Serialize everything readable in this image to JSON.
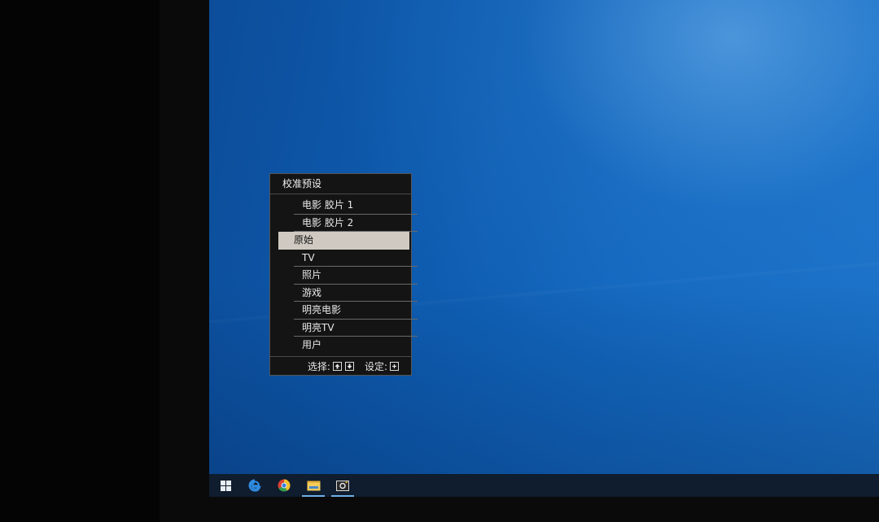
{
  "osd": {
    "title": "校准预设",
    "items": [
      {
        "label": "电影 胶片 1"
      },
      {
        "label": "电影 胶片 2"
      },
      {
        "label": "原始"
      },
      {
        "label": "TV"
      },
      {
        "label": "照片"
      },
      {
        "label": "游戏"
      },
      {
        "label": "明亮电影"
      },
      {
        "label": "明亮TV"
      },
      {
        "label": "用户"
      }
    ],
    "selected_label": "原始",
    "footer": {
      "select_label": "选择:",
      "set_label": "设定:"
    }
  },
  "taskbar": {
    "icons": [
      "windows-start-icon",
      "edge-icon",
      "chrome-icon",
      "file-explorer-icon",
      "camera-app-icon"
    ]
  },
  "colors": {
    "desktop_blue": "#1266bd",
    "osd_background": "#141414",
    "osd_highlight": "#cfc9c1"
  }
}
